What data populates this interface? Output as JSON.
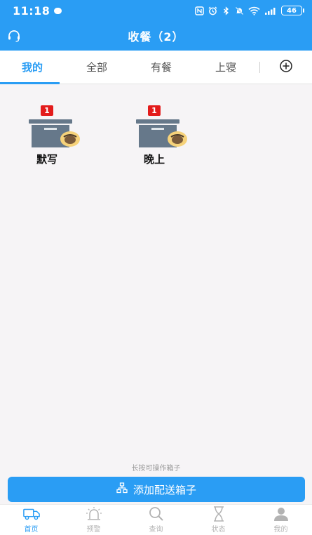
{
  "status_bar": {
    "time": "11:18",
    "battery": "46"
  },
  "header": {
    "title": "收餐（2）"
  },
  "tabs": [
    {
      "label": "我的",
      "active": true
    },
    {
      "label": "全部",
      "active": false
    },
    {
      "label": "有餐",
      "active": false
    },
    {
      "label": "上寝",
      "active": false
    }
  ],
  "boxes": [
    {
      "label": "默写",
      "badge": "1"
    },
    {
      "label": "晚上",
      "badge": "1"
    }
  ],
  "hint": "长按可操作箱子",
  "add_button": {
    "label": "添加配送箱子"
  },
  "bottom_nav": [
    {
      "label": "首页",
      "icon": "truck-icon",
      "active": true
    },
    {
      "label": "预警",
      "icon": "alarm-icon",
      "active": false
    },
    {
      "label": "查询",
      "icon": "search-icon",
      "active": false
    },
    {
      "label": "状态",
      "icon": "hourglass-icon",
      "active": false
    },
    {
      "label": "我的",
      "icon": "user-icon",
      "active": false
    }
  ],
  "colors": {
    "primary": "#2a9df4",
    "badge": "#e31b1b",
    "box": "#66788a",
    "background": "#f6f4f6"
  }
}
